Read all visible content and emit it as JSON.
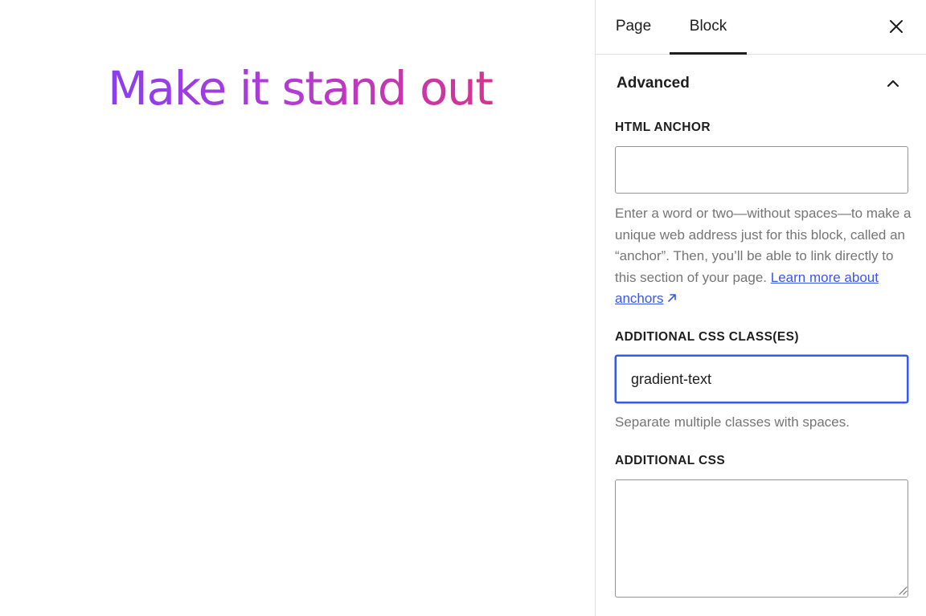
{
  "canvas": {
    "heading": "Make it stand out",
    "gradient": {
      "start": "#8a3ff0",
      "end": "#d6338f"
    }
  },
  "sidebar": {
    "tabs": [
      {
        "label": "Page",
        "active": false
      },
      {
        "label": "Block",
        "active": true
      }
    ],
    "close_icon": "close-icon",
    "panel": {
      "title": "Advanced",
      "expanded": true,
      "toggle_icon": "chevron-up-icon"
    },
    "html_anchor": {
      "label": "HTML ANCHOR",
      "value": "",
      "help_text": "Enter a word or two—without spaces—to make a unique web address just for this block, called an “anchor”. Then, you’ll be able to link directly to this section of your page.",
      "link_text": "Learn more about anchors",
      "link_icon": "external-arrow-icon"
    },
    "css_classes": {
      "label": "ADDITIONAL CSS CLASS(ES)",
      "value": "gradient-text",
      "help_text": "Separate multiple classes with spaces."
    },
    "additional_css": {
      "label": "ADDITIONAL CSS",
      "value": ""
    },
    "accent_color": "#3858e9"
  }
}
